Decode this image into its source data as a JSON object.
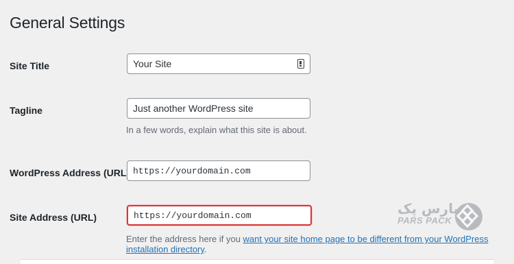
{
  "page": {
    "title": "General Settings"
  },
  "rows": [
    {
      "label": "Site Title",
      "value": "Your Site"
    },
    {
      "label": "Tagline",
      "value": "Just another WordPress site",
      "description": "In a few words, explain what this site is about."
    },
    {
      "label": "WordPress Address (URL)",
      "value": "https://yourdomain.com"
    },
    {
      "label": "Site Address (URL)",
      "value": "https://yourdomain.com",
      "description_prefix": "Enter the address here if you ",
      "description_link": "want your site home page to be different from your WordPress installation directory",
      "description_suffix": "."
    }
  ],
  "watermark": {
    "text_fa": "پارس پک",
    "text_en": "PARS PACK"
  },
  "colors": {
    "background": "#f0f0f1",
    "highlight_border": "#d63638",
    "link": "#2271b1"
  },
  "icons": {
    "site_title_field_icon": "password-manager-icon"
  }
}
